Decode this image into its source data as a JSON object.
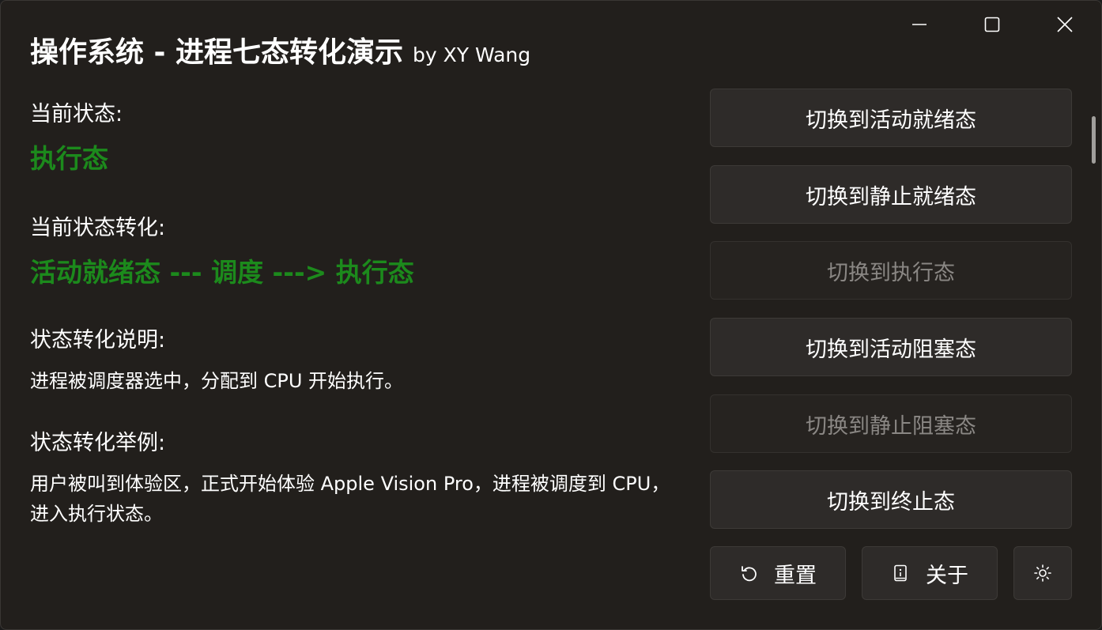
{
  "window": {
    "title": "操作系统 - 进程七态转化演示",
    "subtitle": "by XY Wang",
    "controls": [
      "minimize-icon",
      "maximize-icon",
      "close-icon"
    ]
  },
  "status": {
    "current_state_label": "当前状态:",
    "current_state_value": "执行态",
    "transition_label": "当前状态转化:",
    "transition_value": "活动就绪态 --- 调度 ---> 执行态",
    "explanation_label": "状态转化说明:",
    "explanation_text": "进程被调度器选中，分配到 CPU 开始执行。",
    "example_label": "状态转化举例:",
    "example_text": "用户被叫到体验区，正式开始体验 Apple Vision Pro，进程被调度到 CPU，进入执行状态。"
  },
  "actions": [
    {
      "label": "切换到活动就绪态",
      "enabled": true
    },
    {
      "label": "切换到静止就绪态",
      "enabled": true
    },
    {
      "label": "切换到执行态",
      "enabled": false
    },
    {
      "label": "切换到活动阻塞态",
      "enabled": true
    },
    {
      "label": "切换到静止阻塞态",
      "enabled": false
    },
    {
      "label": "切换到终止态",
      "enabled": true
    }
  ],
  "footer": {
    "reset_label": "重置",
    "reset_icon": "undo-icon",
    "about_label": "关于",
    "about_icon": "info-icon",
    "theme_icon": "sun-icon"
  },
  "colors": {
    "accent_green": "#1c8a1c",
    "background": "#221f1c",
    "button": "#2e2b29",
    "disabled_text": "#8a8784"
  }
}
